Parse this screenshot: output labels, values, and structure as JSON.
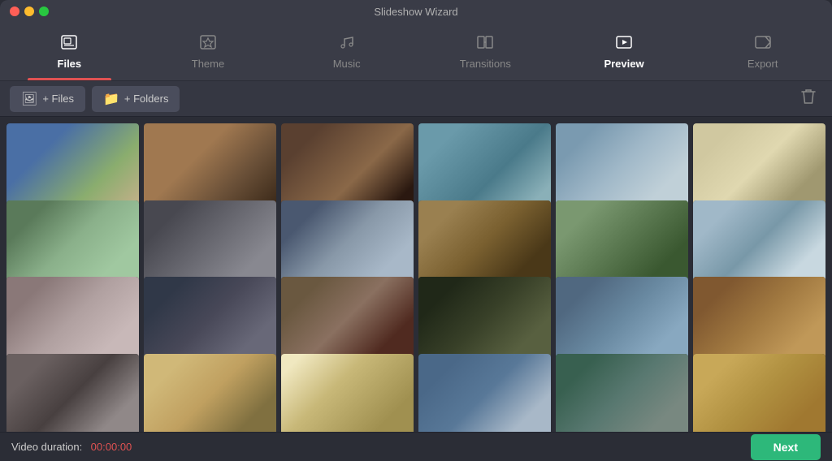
{
  "app": {
    "title": "Slideshow Wizard"
  },
  "traffic_lights": {
    "close": "close",
    "minimize": "minimize",
    "maximize": "maximize"
  },
  "nav": {
    "tabs": [
      {
        "id": "files",
        "label": "Files",
        "icon": "🖼",
        "active": true
      },
      {
        "id": "theme",
        "label": "Theme",
        "icon": "⭐",
        "active": false
      },
      {
        "id": "music",
        "label": "Music",
        "icon": "🎵",
        "active": false
      },
      {
        "id": "transitions",
        "label": "Transitions",
        "icon": "⊡",
        "active": false
      },
      {
        "id": "preview",
        "label": "Preview",
        "icon": "▶",
        "active": false
      },
      {
        "id": "export",
        "label": "Export",
        "icon": "⤴",
        "active": false
      }
    ]
  },
  "toolbar": {
    "add_files_label": "+ Files",
    "add_folders_label": "+ Folders"
  },
  "grid": {
    "items": [
      {
        "id": 1,
        "cls": "p1"
      },
      {
        "id": 2,
        "cls": "p2"
      },
      {
        "id": 3,
        "cls": "p3"
      },
      {
        "id": 4,
        "cls": "p4"
      },
      {
        "id": 5,
        "cls": "p5"
      },
      {
        "id": 6,
        "cls": "p6"
      },
      {
        "id": 7,
        "cls": "p7"
      },
      {
        "id": 8,
        "cls": "p8"
      },
      {
        "id": 9,
        "cls": "p9"
      },
      {
        "id": 10,
        "cls": "p10"
      },
      {
        "id": 11,
        "cls": "p11"
      },
      {
        "id": 12,
        "cls": "p12"
      },
      {
        "id": 13,
        "cls": "p13"
      },
      {
        "id": 14,
        "cls": "p14"
      },
      {
        "id": 15,
        "cls": "p15"
      },
      {
        "id": 16,
        "cls": "p16"
      },
      {
        "id": 17,
        "cls": "p17"
      },
      {
        "id": 18,
        "cls": "p18"
      },
      {
        "id": 19,
        "cls": "p19"
      },
      {
        "id": 20,
        "cls": "p20"
      },
      {
        "id": 21,
        "cls": "p21"
      },
      {
        "id": 22,
        "cls": "p22"
      },
      {
        "id": 23,
        "cls": "p23"
      },
      {
        "id": 24,
        "cls": "p24"
      }
    ]
  },
  "statusbar": {
    "duration_label": "Video duration:",
    "duration_value": "00:00:00",
    "next_button_label": "Next"
  }
}
